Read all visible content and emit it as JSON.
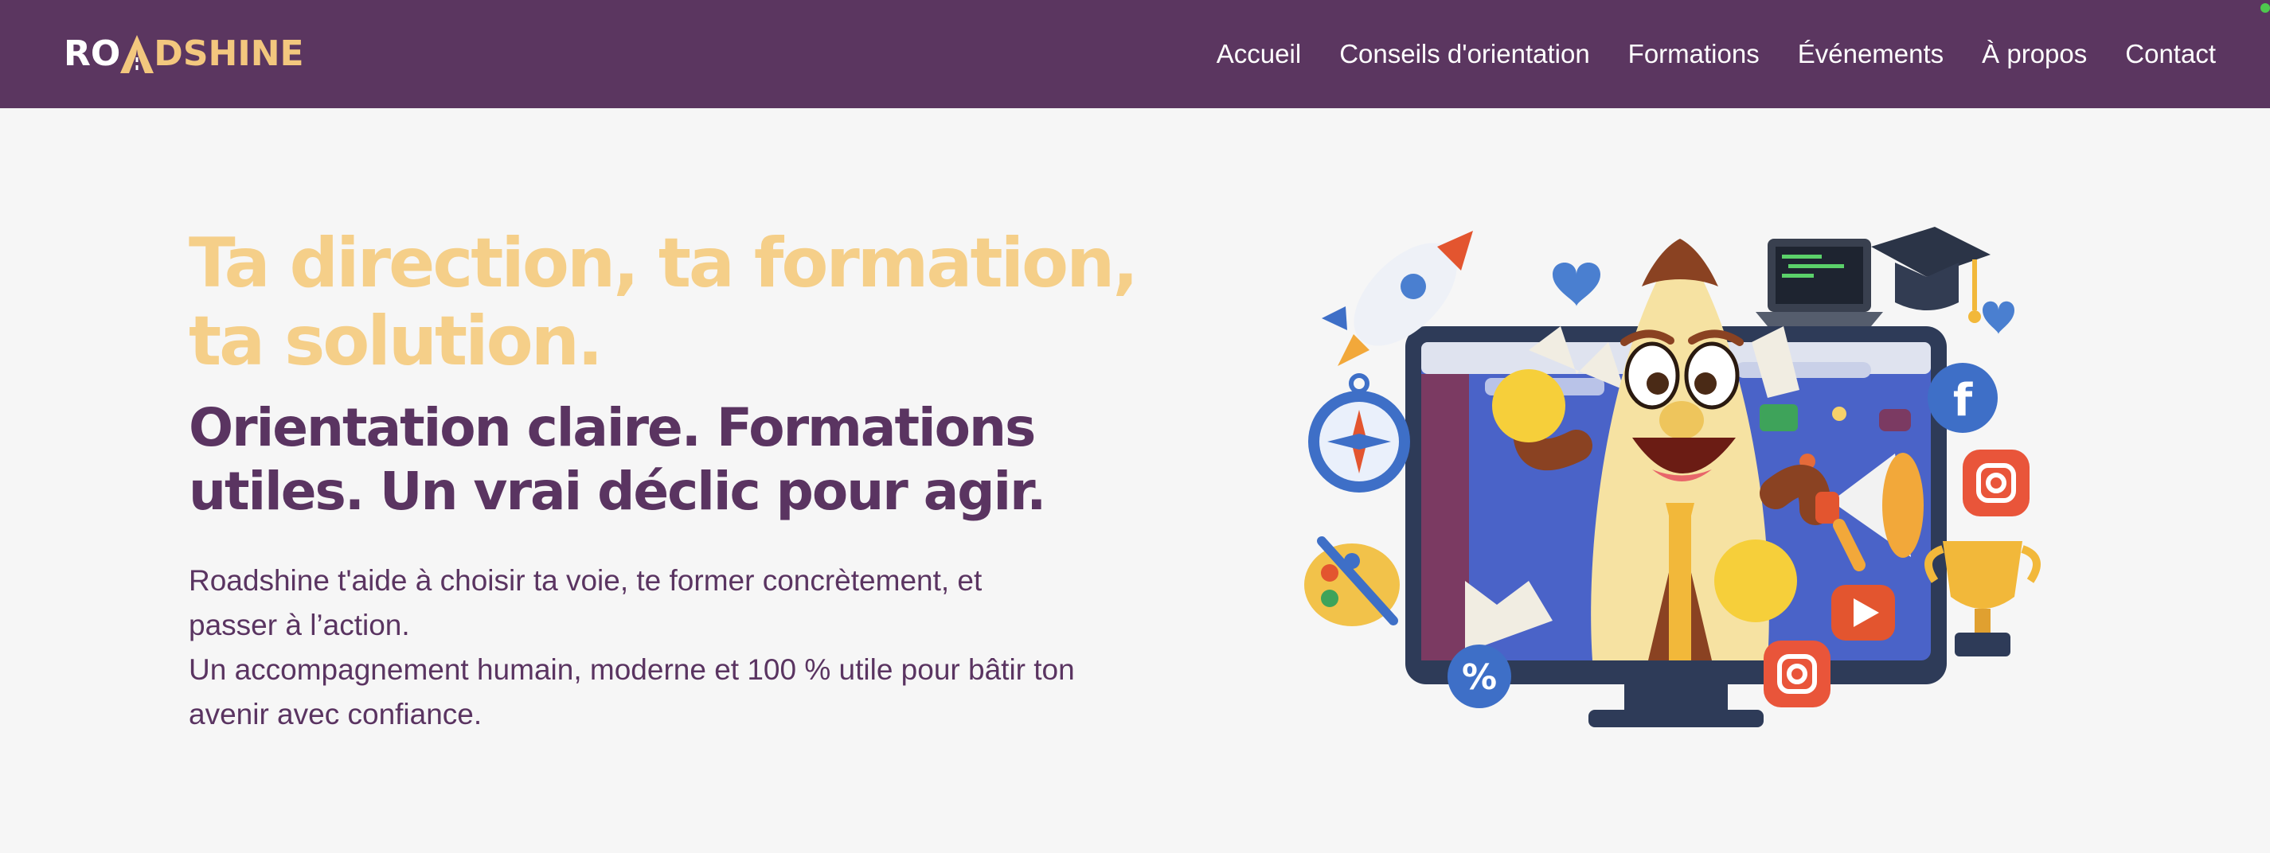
{
  "brand": {
    "name_part1": "RO",
    "name_part2": "D",
    "name_part3": "SHINE",
    "logo_icon": "road-a-icon"
  },
  "nav": {
    "items": [
      {
        "label": "Accueil"
      },
      {
        "label": "Conseils d'orientation"
      },
      {
        "label": "Formations"
      },
      {
        "label": "Événements"
      },
      {
        "label": "À propos"
      },
      {
        "label": "Contact"
      }
    ]
  },
  "hero": {
    "headline_line1": "Ta direction, ta formation,",
    "headline_line2": "ta solution.",
    "subheadline_line1": "Orientation claire. Formations",
    "subheadline_line2": "utiles. Un vrai déclic pour agir.",
    "description_line1": "Roadshine t'aide à choisir ta voie, te former concrètement, et",
    "description_line2": "passer à l’action.",
    "description_line3": "Un accompagnement humain, moderne et 100 % utile pour bâtir ton",
    "description_line4": "avenir avec confiance.",
    "illustration_badge": "%"
  },
  "colors": {
    "nav_bg": "#5b3660",
    "accent_gold": "#f5cf89",
    "brand_purple": "#5a3461",
    "page_bg": "#f6f6f6"
  },
  "icons": [
    "road-a-icon",
    "rocket-icon",
    "heart-icon",
    "laptop-icon",
    "graduation-cap-icon",
    "compass-icon",
    "facebook-icon",
    "instagram-icon",
    "megaphone-icon",
    "palette-icon",
    "trophy-icon",
    "youtube-icon",
    "percent-icon",
    "mascot-illustration"
  ]
}
